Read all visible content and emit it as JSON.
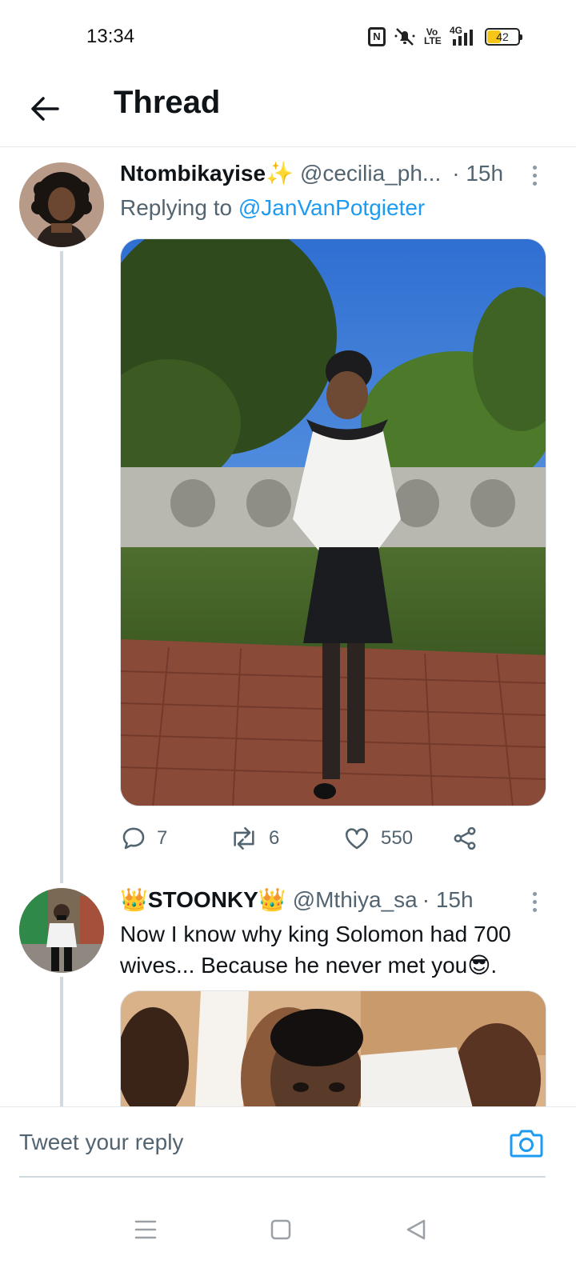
{
  "status_bar": {
    "time": "13:34",
    "icons": [
      "nfc-icon",
      "mute-icon",
      "volte-icon",
      "4g-signal-icon"
    ],
    "volte_text": "Vo LTE",
    "network_text": "4G",
    "battery_level": "42"
  },
  "header": {
    "back_icon": "arrow-left-icon",
    "title": "Thread"
  },
  "tweets": [
    {
      "name": "Ntombikayise✨",
      "handle": "@cecilia_ph...",
      "time": "· 15h",
      "replying_prefix": "Replying to ",
      "replying_to": "@JanVanPotgieter",
      "media_description": "photo",
      "actions": {
        "replies": "7",
        "retweets": "6",
        "likes": "550"
      }
    },
    {
      "name": "👑STOONKY👑",
      "handle": "@Mthiya_sa",
      "time": "· 15h",
      "text": "Now I know why king Solomon had 700 wives... Because he never met you😎."
    }
  ],
  "reply_bar": {
    "placeholder": "Tweet your reply",
    "camera_icon": "camera-icon"
  },
  "nav_bar": {
    "icons": [
      "menu-icon",
      "home-square-icon",
      "back-triangle-icon"
    ]
  },
  "colors": {
    "accent": "#1d9bf0",
    "text_primary": "#0f1419",
    "text_secondary": "#536471",
    "divider": "#e6e8ea"
  }
}
